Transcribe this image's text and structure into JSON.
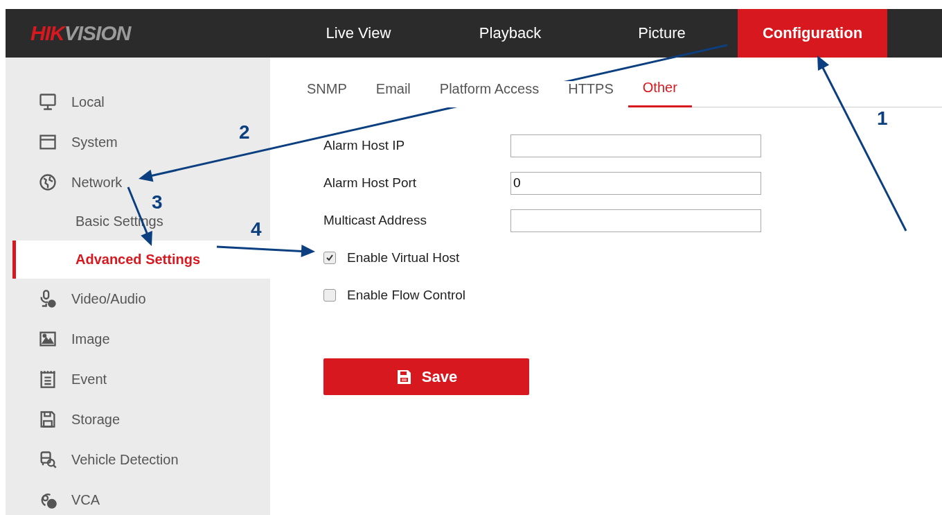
{
  "header": {
    "logo": {
      "part_1": "HIK",
      "part_2": "VISION"
    },
    "nav": [
      {
        "label": "Live View",
        "selected": false
      },
      {
        "label": "Playback",
        "selected": false
      },
      {
        "label": "Picture",
        "selected": false
      },
      {
        "label": "Configuration",
        "selected": true
      }
    ]
  },
  "sidebar": {
    "items": [
      {
        "label": "Local",
        "selected": false
      },
      {
        "label": "System",
        "selected": false
      },
      {
        "label": "Network",
        "selected": false,
        "children": [
          {
            "label": "Basic Settings",
            "selected": false
          },
          {
            "label": "Advanced Settings",
            "selected": true
          }
        ]
      },
      {
        "label": "Video/Audio",
        "selected": false
      },
      {
        "label": "Image",
        "selected": false
      },
      {
        "label": "Event",
        "selected": false
      },
      {
        "label": "Storage",
        "selected": false
      },
      {
        "label": "Vehicle Detection",
        "selected": false
      },
      {
        "label": "VCA",
        "selected": false
      }
    ]
  },
  "tabs": [
    {
      "label": "SNMP",
      "selected": false
    },
    {
      "label": "Email",
      "selected": false
    },
    {
      "label": "Platform Access",
      "selected": false
    },
    {
      "label": "HTTPS",
      "selected": false
    },
    {
      "label": "Other",
      "selected": true
    }
  ],
  "form": {
    "fields": [
      {
        "label": "Alarm Host IP"
      },
      {
        "label": "Alarm Host Port",
        "value": "0"
      },
      {
        "label": "Multicast Address"
      }
    ],
    "checkboxes": [
      {
        "label": "Enable Virtual Host",
        "checked": true
      },
      {
        "label": "Enable Flow Control",
        "checked": false
      }
    ],
    "save_button": "Save"
  },
  "annotations": [
    {
      "label": "1"
    },
    {
      "label": "2"
    },
    {
      "label": "3"
    },
    {
      "label": "4"
    }
  ]
}
